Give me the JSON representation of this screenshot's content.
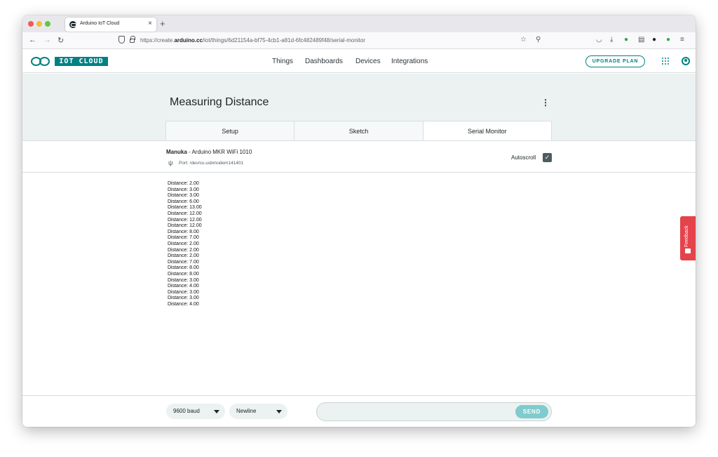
{
  "browser": {
    "tab_title": "Arduino IoT Cloud",
    "tab_close": "×",
    "new_tab": "+",
    "url_prefix": "https://create.",
    "url_domain": "arduino.cc",
    "url_path": "/iot/things/6d21154a-bf75-4cb1-a81d-6fc482489f48/serial-monitor"
  },
  "header": {
    "logo_text": "IOT CLOUD",
    "nav": [
      "Things",
      "Dashboards",
      "Devices",
      "Integrations"
    ],
    "upgrade": "UPGRADE PLAN"
  },
  "thing": {
    "title": "Measuring Distance",
    "tabs": [
      "Setup",
      "Sketch",
      "Serial Monitor"
    ],
    "active_tab": "Serial Monitor"
  },
  "device": {
    "name_bold": "Manuka",
    "name_rest": " - Arduino MKR WiFi 1010",
    "port": "Port: /dev/cu.usbmodem141401",
    "autoscroll_label": "Autoscroll",
    "autoscroll_checked": true
  },
  "monitor": {
    "lines": [
      "Distance: 2.00",
      "Distance: 3.00",
      "Distance: 3.00",
      "Distance: 6.00",
      "Distance: 13.00",
      "Distance: 12.00",
      "Distance: 12.00",
      "Distance: 12.00",
      "Distance: 8.00",
      "Distance: 7.00",
      "Distance: 2.00",
      "Distance: 2.00",
      "Distance: 2.00",
      "Distance: 7.00",
      "Distance: 8.00",
      "Distance: 8.00",
      "Distance: 3.00",
      "Distance: 4.00",
      "Distance: 3.00",
      "Distance: 3.00",
      "Distance: 4.00"
    ]
  },
  "feedback": {
    "label": "Feedback"
  },
  "footer": {
    "baud": "9600 baud",
    "line_ending": "Newline",
    "message_placeholder": "",
    "send": "SEND"
  },
  "colors": {
    "accent": "#008184",
    "header_bg": "#ecf1f1",
    "feedback": "#e5434b"
  }
}
